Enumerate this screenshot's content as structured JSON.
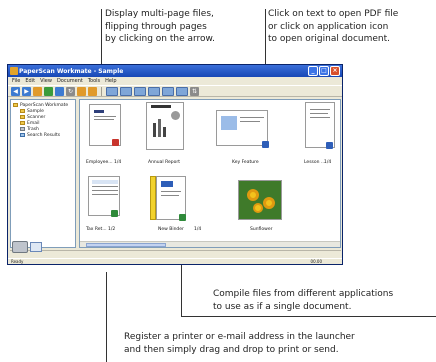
{
  "callouts": {
    "multipage": [
      "Display multi-page files,",
      "flipping through pages",
      "by clicking on the arrow."
    ],
    "open_pdf": [
      "Click on text to open PDF file",
      "or click on application icon",
      "to open original document."
    ],
    "compile": [
      "Compile files from different applications",
      "to use as if a single document."
    ],
    "launcher": [
      "Register a printer or e-mail address in the launcher",
      "and then simply drag and drop to print or send."
    ]
  },
  "window": {
    "title": "PaperScan Workmate - Sample",
    "menus": [
      "File",
      "Edit",
      "View",
      "Document",
      "Tools",
      "Help"
    ],
    "tree": [
      {
        "label": "PaperScan Workmate",
        "level": 0
      },
      {
        "label": "Sample",
        "level": 1
      },
      {
        "label": "Scanner",
        "level": 1
      },
      {
        "label": "Email",
        "level": 1
      },
      {
        "label": "Trash",
        "level": 1
      },
      {
        "label": "Search Results",
        "level": 1
      }
    ],
    "thumbnails": [
      {
        "label": "Employee...",
        "count": "1/4"
      },
      {
        "label": "Annual Report",
        "count": ""
      },
      {
        "label": "Key Feature",
        "count": ""
      },
      {
        "label": "Lesson ...",
        "count": "1/4"
      },
      {
        "label": "Tax Ret... 1/2",
        "count": ""
      },
      {
        "label": "New Binder",
        "count": "1/4"
      },
      {
        "label": "Sunflower",
        "count": ""
      }
    ],
    "status": {
      "left": "Ready",
      "right": "00.00"
    }
  },
  "colors": {
    "titlebar": "#245edb",
    "window_bg": "#ece9d8",
    "binder_yellow": "#f2d22c",
    "callout_line": "#333333"
  },
  "icons": [
    "app-icon",
    "folder-icon",
    "printer-icon",
    "mail-icon",
    "pdf-badge-icon",
    "excel-badge-icon",
    "word-badge-icon"
  ]
}
